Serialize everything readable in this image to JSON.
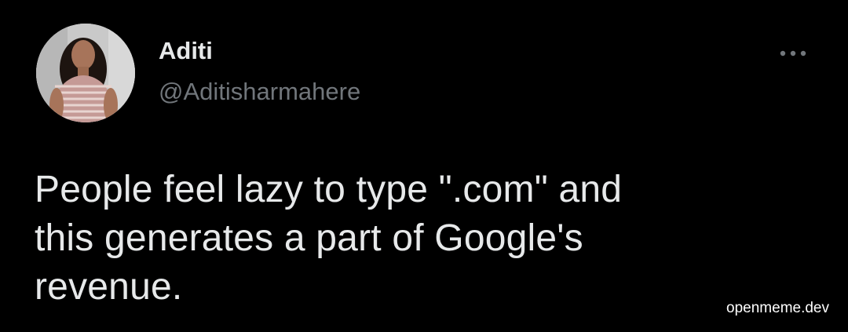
{
  "author": {
    "display_name": "Aditi",
    "handle": "@Aditisharmahere",
    "avatar_icon": "avatar-photo"
  },
  "tweet": {
    "lines": [
      "People feel lazy to type \".com\" and",
      "this generates a part of Google's",
      "revenue."
    ]
  },
  "more_icon": "more-horizontal-icon",
  "watermark": "openmeme.dev",
  "colors": {
    "background": "#000000",
    "primary_text": "#e7e9ea",
    "secondary_text": "#71767b"
  }
}
